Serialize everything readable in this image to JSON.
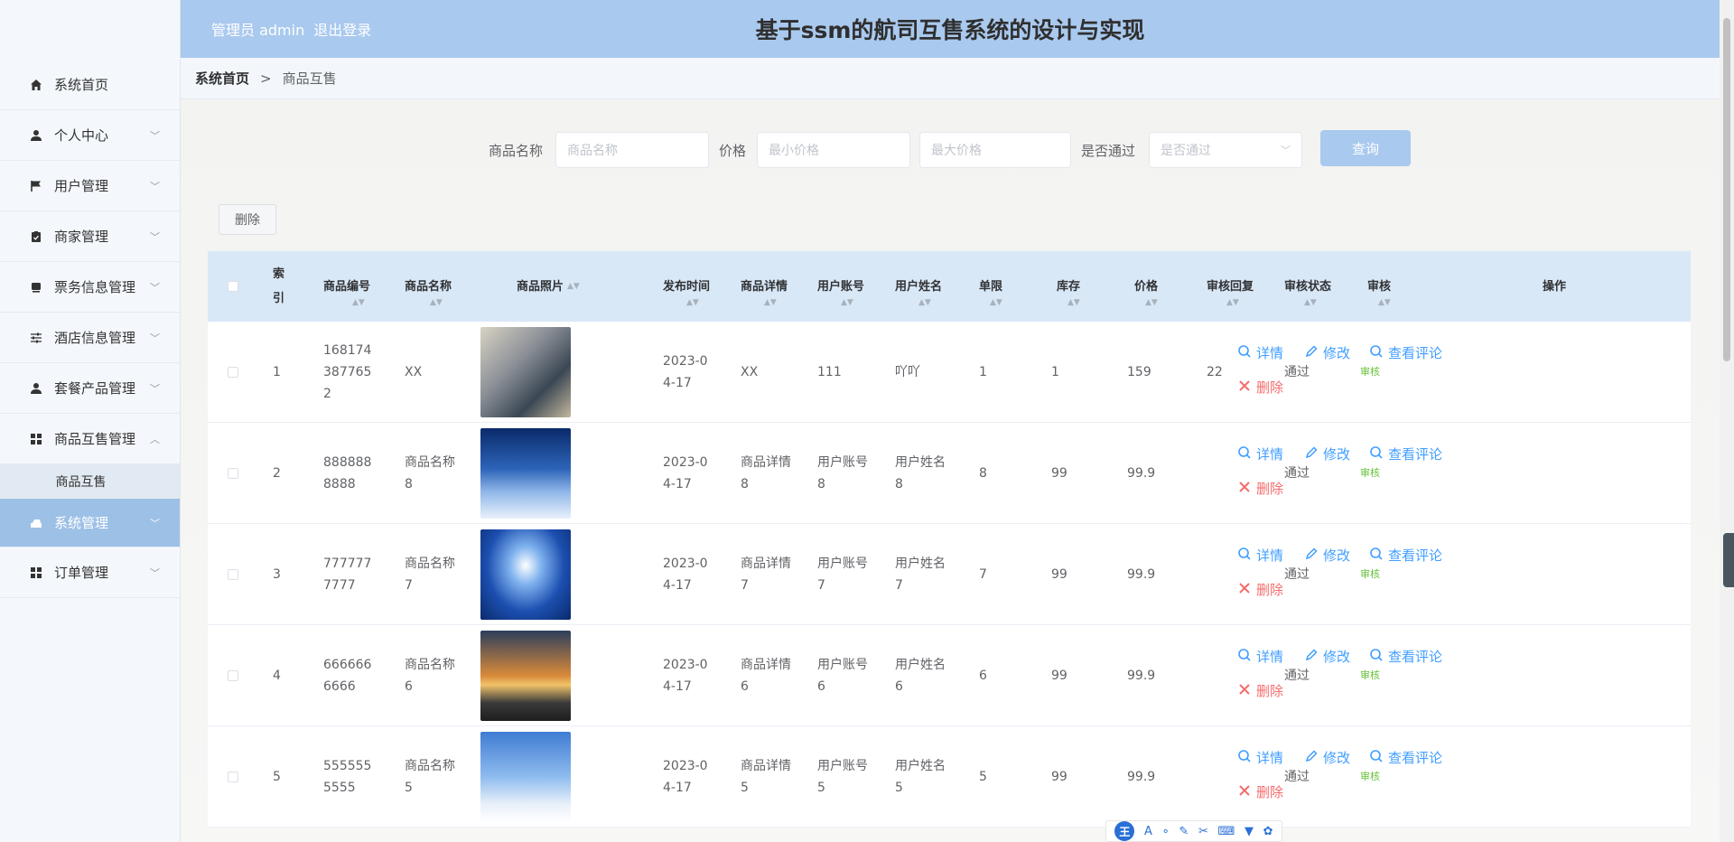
{
  "header": {
    "admin_text": "管理员 admin",
    "logout": "退出登录",
    "title": "基于ssm的航司互售系统的设计与实现"
  },
  "sidebar": {
    "items": [
      {
        "label": "系统首页",
        "icon": "home-icon"
      },
      {
        "label": "个人中心",
        "icon": "user-icon"
      },
      {
        "label": "用户管理",
        "icon": "flag-icon"
      },
      {
        "label": "商家管理",
        "icon": "clipboard-icon"
      },
      {
        "label": "票务信息管理",
        "icon": "ticket-icon"
      },
      {
        "label": "酒店信息管理",
        "icon": "sliders-icon"
      },
      {
        "label": "套餐产品管理",
        "icon": "person-icon"
      },
      {
        "label": "商品互售管理",
        "icon": "grid-icon"
      },
      {
        "label": "系统管理",
        "icon": "system-icon"
      },
      {
        "label": "订单管理",
        "icon": "grid-icon"
      }
    ],
    "sub_item": "商品互售"
  },
  "breadcrumb": {
    "home": "系统首页",
    "separator": ">",
    "current": "商品互售"
  },
  "search": {
    "name_label": "商品名称",
    "name_placeholder": "商品名称",
    "price_label": "价格",
    "min_placeholder": "最小价格",
    "max_placeholder": "最大价格",
    "pass_label": "是否通过",
    "pass_placeholder": "是否通过",
    "query_button": "查询"
  },
  "toolbar": {
    "delete_button": "删除"
  },
  "table": {
    "headers": {
      "index": "索引",
      "code": "商品编号",
      "name": "商品名称",
      "photo": "商品照片",
      "date": "发布时间",
      "detail": "商品详情",
      "account": "用户账号",
      "username": "用户姓名",
      "limit": "单限",
      "stock": "库存",
      "price": "价格",
      "reply": "审核回复",
      "status": "审核状态",
      "audit": "审核",
      "ops": "操作"
    },
    "rows": [
      {
        "index": "1",
        "code": "1681743877652",
        "name": "XX",
        "date": "2023-04-17",
        "detail": "XX",
        "account": "111",
        "username": "吖吖",
        "limit": "1",
        "stock": "1",
        "price": "159",
        "reply": "22",
        "status": "通过",
        "audit": "审核",
        "photo": "city-photo"
      },
      {
        "index": "2",
        "code": "8888888888",
        "name": "商品名称8",
        "date": "2023-04-17",
        "detail": "商品详情8",
        "account": "用户账号8",
        "username": "用户姓名8",
        "limit": "8",
        "stock": "99",
        "price": "99.9",
        "reply": "",
        "status": "通过",
        "audit": "审核",
        "photo": "wing-photo"
      },
      {
        "index": "3",
        "code": "7777777777",
        "name": "商品名称7",
        "date": "2023-04-17",
        "detail": "商品详情7",
        "account": "用户账号7",
        "username": "用户姓名7",
        "limit": "7",
        "stock": "99",
        "price": "99.9",
        "reply": "",
        "status": "通过",
        "audit": "审核",
        "photo": "plane-blue-photo"
      },
      {
        "index": "4",
        "code": "6666666666",
        "name": "商品名称6",
        "date": "2023-04-17",
        "detail": "商品详情6",
        "account": "用户账号6",
        "username": "用户姓名6",
        "limit": "6",
        "stock": "99",
        "price": "99.9",
        "reply": "",
        "status": "通过",
        "audit": "审核",
        "photo": "sunset-plane-photo"
      },
      {
        "index": "5",
        "code": "5555555555",
        "name": "商品名称5",
        "date": "2023-04-17",
        "detail": "商品详情5",
        "account": "用户账号5",
        "username": "用户姓名5",
        "limit": "5",
        "stock": "99",
        "price": "99.9",
        "reply": "",
        "status": "通过",
        "audit": "审核",
        "photo": "clouds-plane-photo"
      }
    ],
    "ops": {
      "detail": "详情",
      "edit": "修改",
      "comments": "查看评论",
      "delete": "删除"
    }
  },
  "colors": {
    "accent": "#a9c9ee",
    "link": "#409eff",
    "danger": "#f56c6c",
    "success": "#67c23a"
  }
}
